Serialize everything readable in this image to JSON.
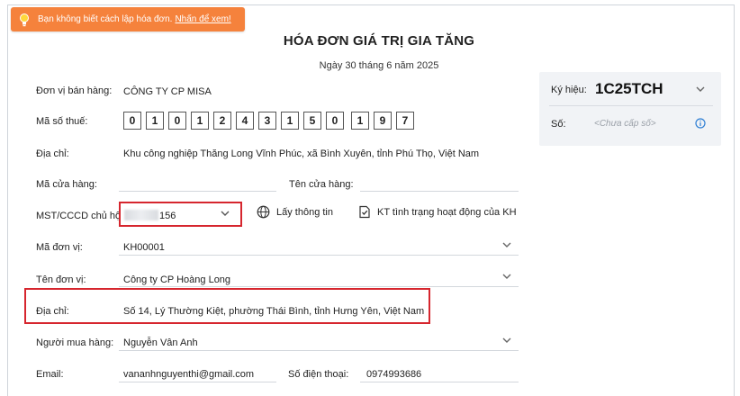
{
  "tip": {
    "text": "Bạn không biết cách lập hóa đơn.",
    "link": "Nhấn để xem!"
  },
  "invoice": {
    "title": "HÓA ĐƠN GIÁ TRỊ GIA TĂNG",
    "date": "Ngày 30 tháng 6 năm 2025"
  },
  "sidebar": {
    "symbol_label": "Ký hiệu:",
    "symbol_value": "1C25TCH",
    "number_label": "Số:",
    "number_placeholder": "<Chưa cấp số>"
  },
  "seller": {
    "unit_label": "Đơn vị bán hàng:",
    "unit_value": "CÔNG TY CP MISA",
    "tax_label": "Mã số thuế:",
    "tax_digits": [
      "0",
      "1",
      "0",
      "1",
      "2",
      "4",
      "3",
      "1",
      "5",
      "0",
      "1",
      "9",
      "7"
    ],
    "address_label": "Địa chỉ:",
    "address_value": "Khu công nghiệp Thăng Long Vĩnh Phúc, xã Bình Xuyên, tỉnh Phú Thọ, Việt Nam",
    "store_code_label": "Mã cửa hàng:",
    "store_name_label": "Tên cửa hàng:"
  },
  "buyer": {
    "id_label": "MST/CCCD chủ hộ",
    "id_value_suffix": "156",
    "fetch_info_button": "Lấy thông tin",
    "check_status_button": "KT tình trạng hoạt động của KH",
    "unit_code_label": "Mã đơn vị:",
    "unit_code_value": "KH00001",
    "unit_name_label": "Tên đơn vị:",
    "unit_name_value": "Công ty CP Hoàng Long",
    "address_label": "Địa chỉ:",
    "address_value": "Số 14, Lý Thường Kiệt, phường Thái Bình, tỉnh Hưng Yên, Việt Nam",
    "buyer_label": "Người mua hàng:",
    "buyer_value": "Nguyễn Vân Anh",
    "email_label": "Email:",
    "email_value": "vananhnguyenthi@gmail.com",
    "phone_label": "Số điện thoại:",
    "phone_value": "0974993686"
  },
  "colors": {
    "tip_bg": "#f5823c",
    "highlight": "#d6262e",
    "info_icon": "#2f7fd4"
  },
  "icons": [
    "lightbulb-icon",
    "globe-icon",
    "check-document-icon",
    "chevron-down-icon",
    "info-icon"
  ]
}
